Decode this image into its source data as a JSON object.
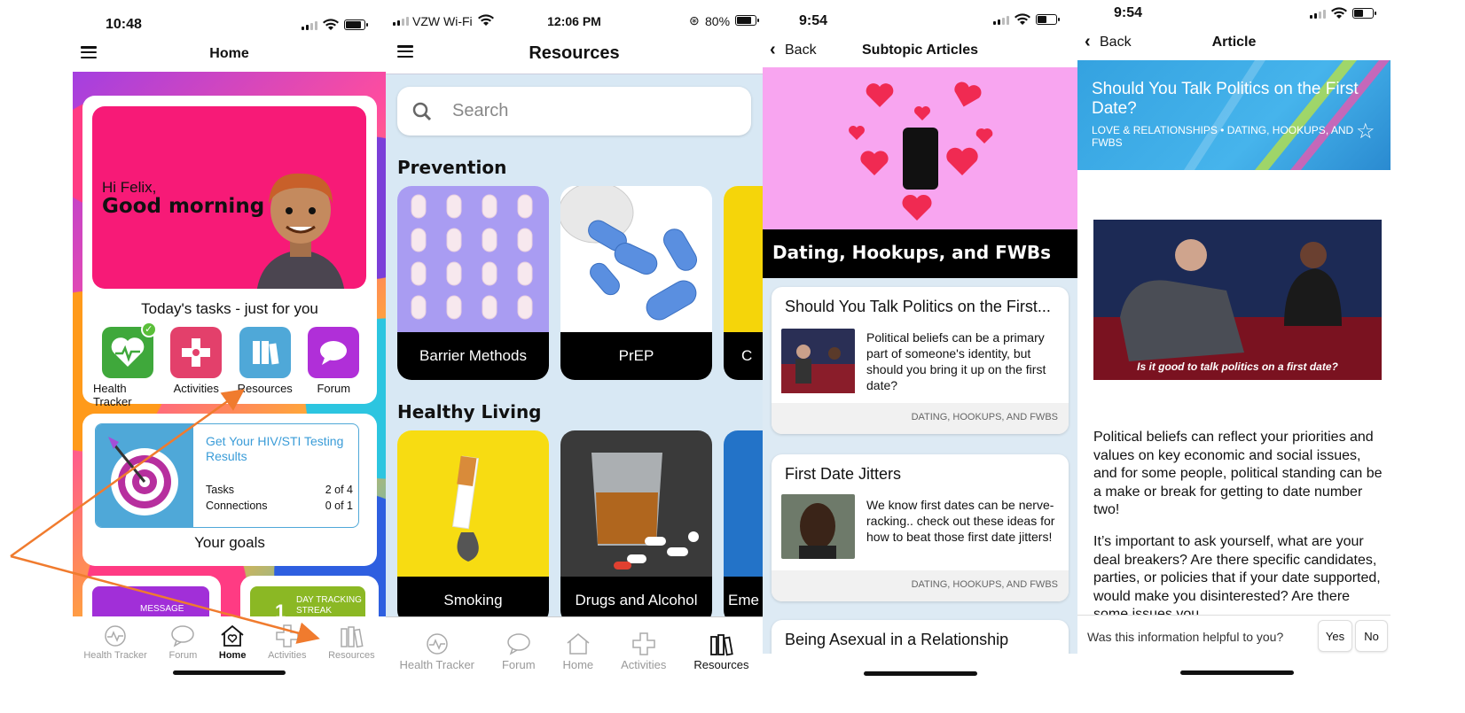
{
  "screen1": {
    "time": "10:48",
    "title": "Home",
    "greeting_hi": "Hi Felix,",
    "greeting_main": "Good morning",
    "tasks_heading": "Today's tasks - just for you",
    "tasks": [
      {
        "label": "Health Tracker",
        "icon": "heart-icon",
        "color": "#3fa83b"
      },
      {
        "label": "Activities",
        "icon": "puzzle-icon",
        "color": "#e3406b"
      },
      {
        "label": "Resources",
        "icon": "books-icon",
        "color": "#4fa8d8"
      },
      {
        "label": "Forum",
        "icon": "chat-bubble-icon",
        "color": "#b02fd8"
      }
    ],
    "goal": {
      "title": "Get Your HIV/STI Testing Results",
      "tasks_label": "Tasks",
      "tasks_value": "2 of 4",
      "connections_label": "Connections",
      "connections_value": "0 of 1"
    },
    "goals_label": "Your goals",
    "mini_cards": [
      "MESSAGE",
      "DAY TRACKING STREAK"
    ],
    "mini_number": "1",
    "tabs": [
      {
        "label": "Health Tracker",
        "icon": "health-tracker-icon"
      },
      {
        "label": "Forum",
        "icon": "forum-icon"
      },
      {
        "label": "Home",
        "icon": "home-icon"
      },
      {
        "label": "Activities",
        "icon": "activities-icon"
      },
      {
        "label": "Resources",
        "icon": "resources-icon"
      }
    ]
  },
  "screen2": {
    "carrier": "VZW Wi-Fi",
    "time": "12:06 PM",
    "battery": "80%",
    "title": "Resources",
    "search_placeholder": "Search",
    "section1": "Prevention",
    "section1_tiles": [
      "Barrier Methods",
      "PrEP",
      "C"
    ],
    "section2": "Healthy Living",
    "section2_tiles": [
      "Smoking",
      "Drugs and Alcohol",
      "Eme"
    ],
    "tabs": [
      {
        "label": "Health Tracker"
      },
      {
        "label": "Forum"
      },
      {
        "label": "Home"
      },
      {
        "label": "Activities"
      },
      {
        "label": "Resources"
      }
    ]
  },
  "screen3": {
    "time": "9:54",
    "back": "Back",
    "title": "Subtopic Articles",
    "banner": "Dating, Hookups, and FWBs",
    "articles": [
      {
        "title": "Should You Talk Politics on the First...",
        "desc": "Political beliefs can be a primary part of someone's identity, but should you bring it up on the first date?",
        "tag": "DATING, HOOKUPS, AND FWBS"
      },
      {
        "title": "First Date Jitters",
        "desc": "We know first dates can be nerve-racking.. check out these ideas for how to beat those first date jitters!",
        "tag": "DATING, HOOKUPS, AND FWBS"
      },
      {
        "title": "Being Asexual in a Relationship"
      }
    ]
  },
  "screen4": {
    "time": "9:54",
    "back": "Back",
    "title": "Article",
    "headline": "Should You Talk Politics on the First Date?",
    "category": "LOVE & RELATIONSHIPS • DATING, HOOKUPS, AND FWBS",
    "caption": "Is it good to talk politics on a first date?",
    "para1": "Political beliefs can reflect your priorities and values on key economic and social issues, and for some people, political standing can be a make or break for getting to date number two!",
    "para2": "It’s important to ask yourself, what are your deal breakers? Are there specific candidates, parties, or policies that if your date supported, would make you disinterested? Are there some issues you",
    "feedback_q": "Was this information helpful to you?",
    "yes": "Yes",
    "no": "No"
  },
  "colors": {
    "arrow": "#f07b2e",
    "hero": "#f71a77",
    "link": "#3a9cd8"
  }
}
